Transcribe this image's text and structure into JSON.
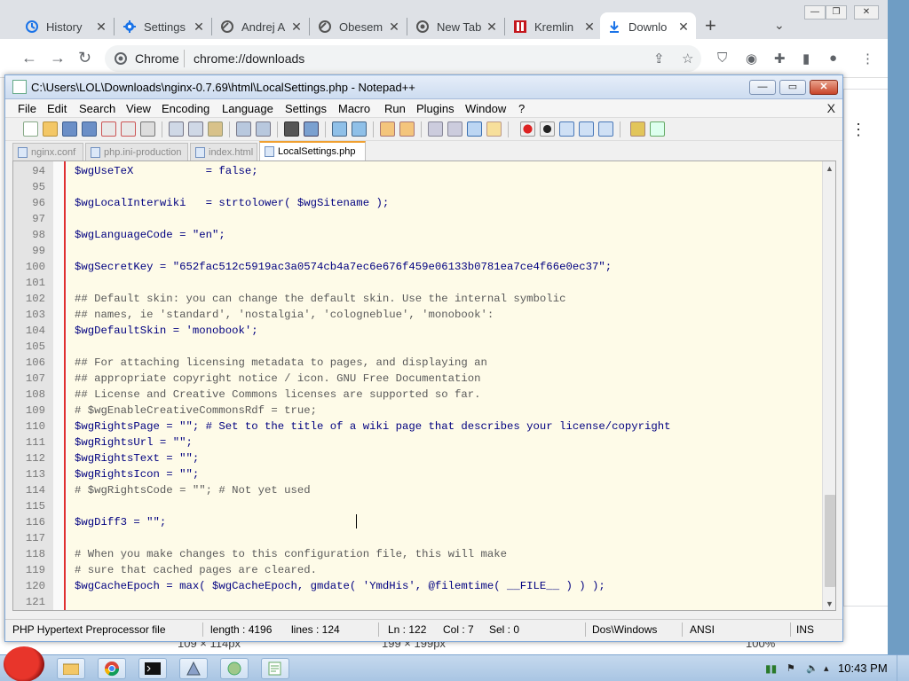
{
  "chrome": {
    "tabs": [
      {
        "label": "History",
        "icon": "history-icon"
      },
      {
        "label": "Settings",
        "icon": "gear-icon"
      },
      {
        "label": "Andrej A",
        "icon": "globe-icon"
      },
      {
        "label": "Obesem",
        "icon": "globe-icon"
      },
      {
        "label": "New Tab",
        "icon": "chrome-icon"
      },
      {
        "label": "Kremlin",
        "icon": "kremlin-site-icon"
      },
      {
        "label": "Downlo",
        "icon": "download-icon"
      }
    ],
    "new_tab": "+",
    "close_glyph": "✕",
    "omnibox_site": "Chrome",
    "omnibox_url": "chrome://downloads",
    "bottom_texts": [
      "109 × 114px",
      "199 × 199px",
      "100%"
    ]
  },
  "npp": {
    "title": "C:\\Users\\LOL\\Downloads\\nginx-0.7.69\\html\\LocalSettings.php - Notepad++",
    "menu": [
      "File",
      "Edit",
      "Search",
      "View",
      "Encoding",
      "Language",
      "Settings",
      "Macro",
      "Run",
      "Plugins",
      "Window",
      "?"
    ],
    "menu_close": "X",
    "tabs": [
      {
        "label": "nginx.conf",
        "active": false
      },
      {
        "label": "php.ini-production",
        "active": false
      },
      {
        "label": "index.html",
        "active": false
      },
      {
        "label": "LocalSettings.php",
        "active": true
      }
    ],
    "lines": [
      {
        "n": "94",
        "text": "$wgUseTeX           = false;"
      },
      {
        "n": "95",
        "text": ""
      },
      {
        "n": "96",
        "text": "$wgLocalInterwiki   = strtolower( $wgSitename );"
      },
      {
        "n": "97",
        "text": ""
      },
      {
        "n": "98",
        "text": "$wgLanguageCode = \"en\";"
      },
      {
        "n": "99",
        "text": ""
      },
      {
        "n": "100",
        "text": "$wgSecretKey = \"652fac512c5919ac3a0574cb4a7ec6e676f459e06133b0781ea7ce4f66e0ec37\";"
      },
      {
        "n": "101",
        "text": ""
      },
      {
        "n": "102",
        "text": "## Default skin: you can change the default skin. Use the internal symbolic"
      },
      {
        "n": "103",
        "text": "## names, ie 'standard', 'nostalgia', 'cologneblue', 'monobook':"
      },
      {
        "n": "104",
        "text": "$wgDefaultSkin = 'monobook';"
      },
      {
        "n": "105",
        "text": ""
      },
      {
        "n": "106",
        "text": "## For attaching licensing metadata to pages, and displaying an"
      },
      {
        "n": "107",
        "text": "## appropriate copyright notice / icon. GNU Free Documentation"
      },
      {
        "n": "108",
        "text": "## License and Creative Commons licenses are supported so far."
      },
      {
        "n": "109",
        "text": "# $wgEnableCreativeCommonsRdf = true;"
      },
      {
        "n": "110",
        "text": "$wgRightsPage = \"\"; # Set to the title of a wiki page that describes your license/copyright"
      },
      {
        "n": "111",
        "text": "$wgRightsUrl = \"\";"
      },
      {
        "n": "112",
        "text": "$wgRightsText = \"\";"
      },
      {
        "n": "113",
        "text": "$wgRightsIcon = \"\";"
      },
      {
        "n": "114",
        "text": "# $wgRightsCode = \"\"; # Not yet used"
      },
      {
        "n": "115",
        "text": ""
      },
      {
        "n": "116",
        "text": "$wgDiff3 = \"\";"
      },
      {
        "n": "117",
        "text": ""
      },
      {
        "n": "118",
        "text": "# When you make changes to this configuration file, this will make"
      },
      {
        "n": "119",
        "text": "# sure that cached pages are cleared."
      },
      {
        "n": "120",
        "text": "$wgCacheEpoch = max( $wgCacheEpoch, gmdate( 'YmdHis', @filemtime( __FILE__ ) ) );"
      },
      {
        "n": "121",
        "text": ""
      }
    ],
    "status": {
      "filetype": "PHP Hypertext Preprocessor file",
      "length": "length : 4196",
      "lines": "lines : 124",
      "ln": "Ln : 122",
      "col": "Col : 7",
      "sel": "Sel : 0",
      "eol": "Dos\\Windows",
      "encoding": "ANSI",
      "mode": "INS"
    }
  },
  "taskbar": {
    "clock": "10:43 PM"
  },
  "colors": {
    "editor_bg": "#fefbe8",
    "fold_line": "#e03030",
    "active_tab_accent": "#f0a030"
  }
}
